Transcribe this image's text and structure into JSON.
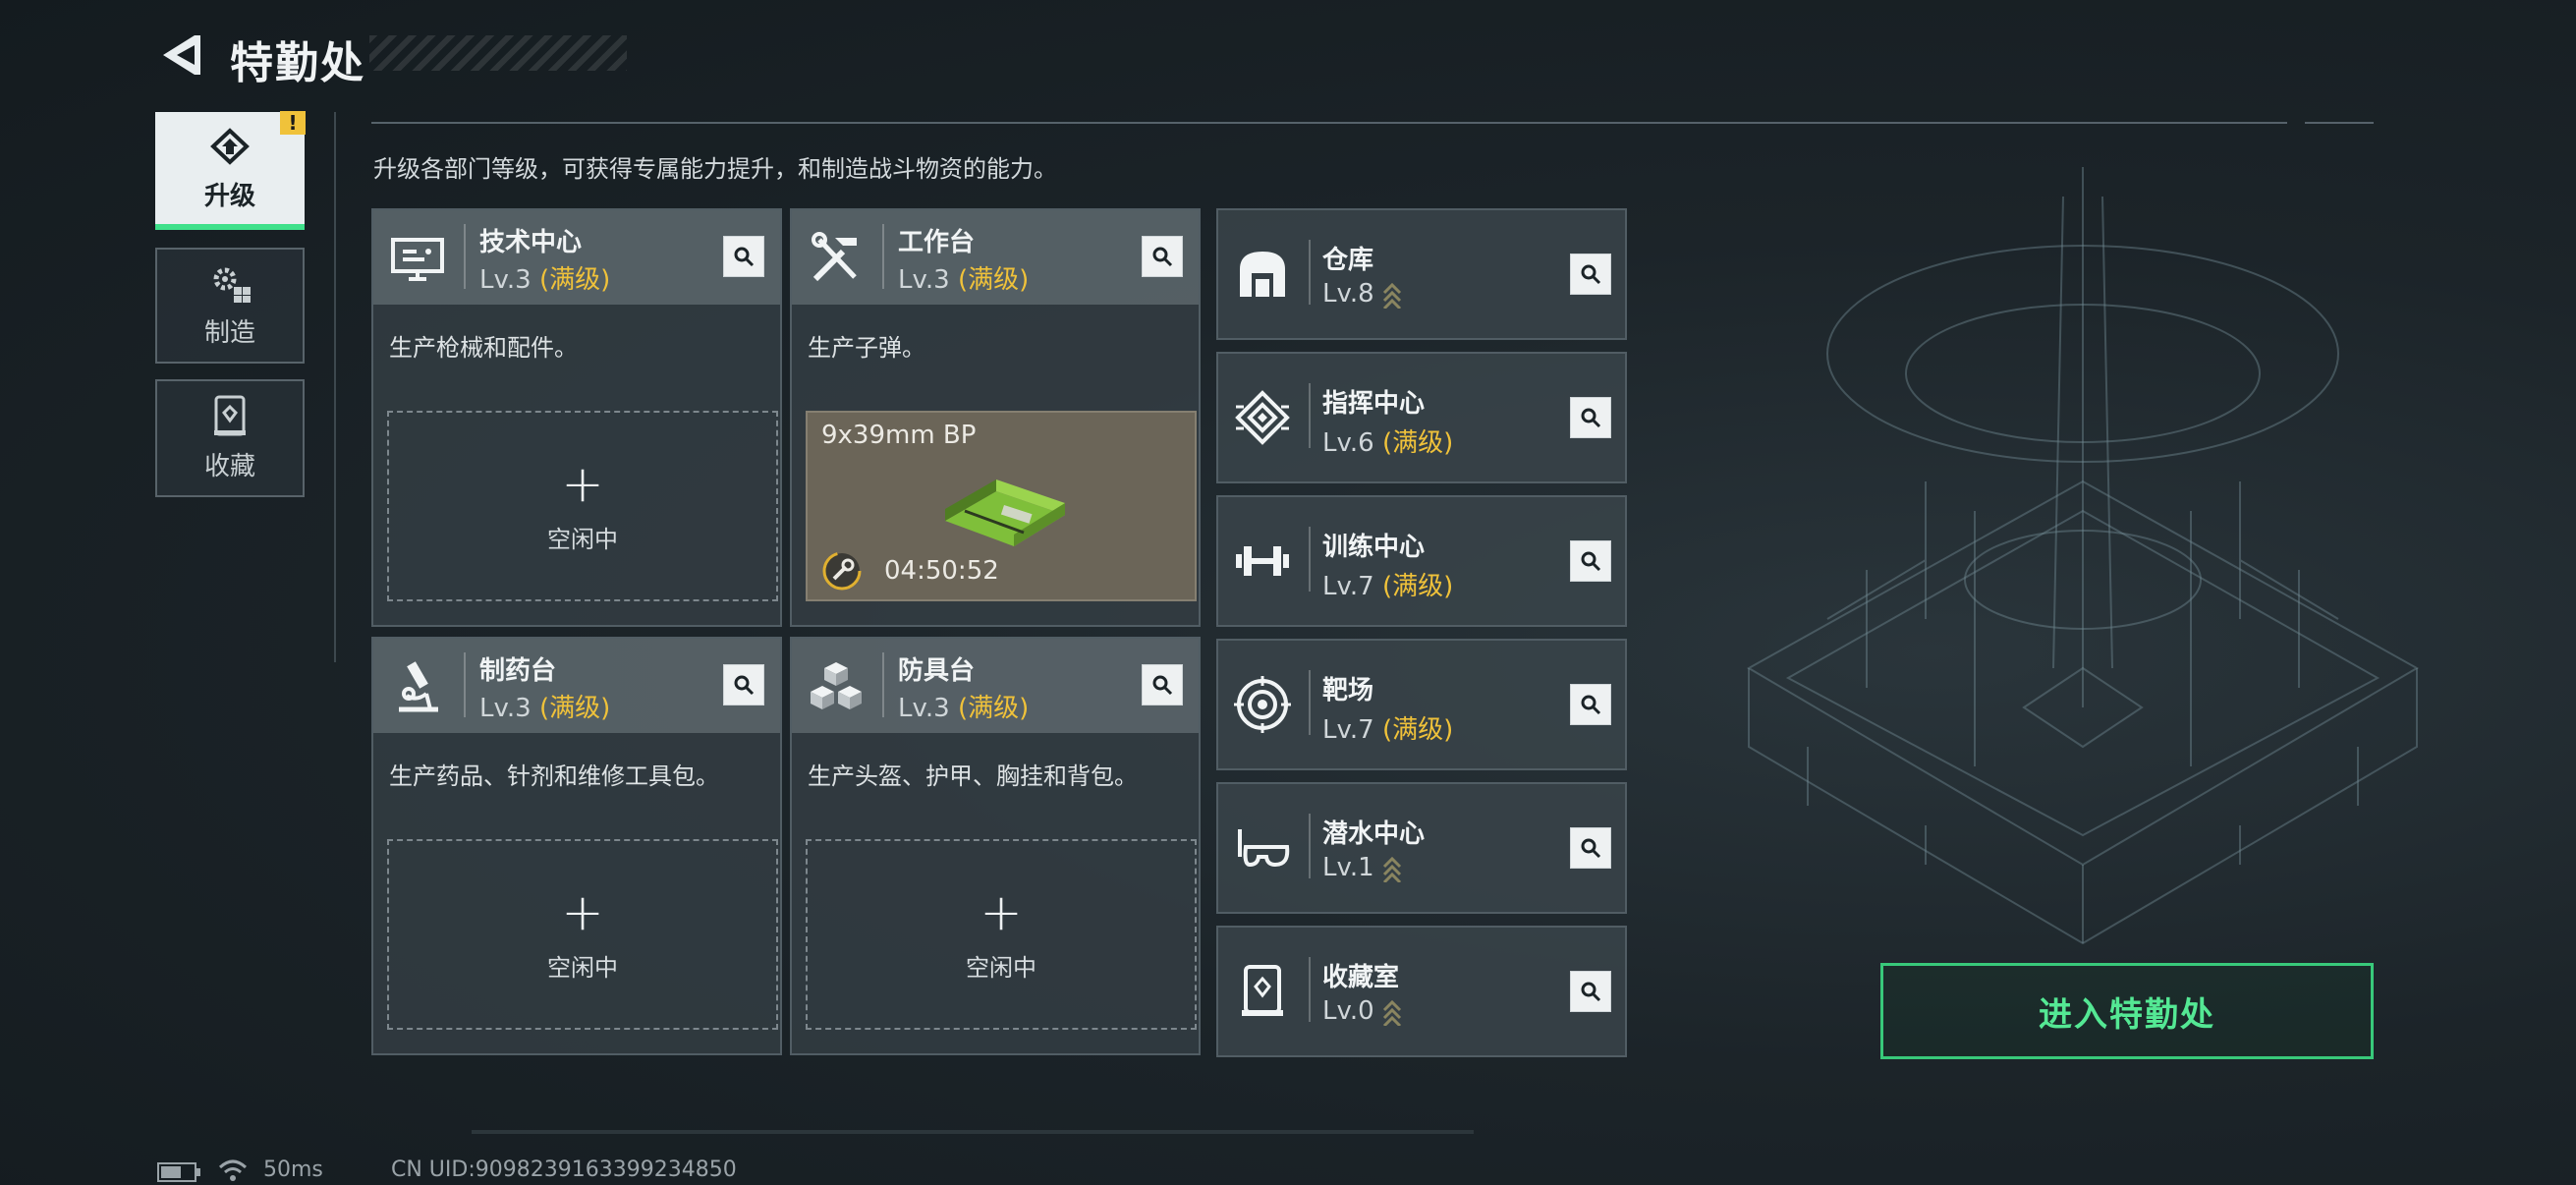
{
  "header": {
    "title": "特勤处",
    "back_icon": "back-arrow-icon"
  },
  "nav": [
    {
      "label": "升级",
      "icon": "upgrade-icon",
      "active": true,
      "alert": "!"
    },
    {
      "label": "制造",
      "icon": "gears-icon",
      "active": false
    },
    {
      "label": "收藏",
      "icon": "collection-icon",
      "active": false
    }
  ],
  "subtitle": "升级各部门等级，可获得专属能力提升，和制造战斗物资的能力。",
  "big_cards": [
    {
      "name": "技术中心",
      "level": "Lv.3",
      "status": "(满级)",
      "desc": "生产枪械和配件。",
      "icon": "monitor-icon",
      "slot": {
        "state": "idle",
        "plus": "+",
        "text": "空闲中"
      }
    },
    {
      "name": "工作台",
      "level": "Lv.3",
      "status": "(满级)",
      "desc": "生产子弹。",
      "icon": "tools-icon",
      "slot": {
        "state": "producing",
        "item": "9x39mm BP",
        "timer": "04:50:52"
      }
    },
    {
      "name": "制药台",
      "level": "Lv.3",
      "status": "(满级)",
      "desc": "生产药品、针剂和维修工具包。",
      "icon": "microscope-icon",
      "slot": {
        "state": "idle",
        "plus": "+",
        "text": "空闲中"
      }
    },
    {
      "name": "防具台",
      "level": "Lv.3",
      "status": "(满级)",
      "desc": "生产头盔、护甲、胸挂和背包。",
      "icon": "armor-cubes-icon",
      "slot": {
        "state": "idle",
        "plus": "+",
        "text": "空闲中"
      }
    }
  ],
  "small_cards": [
    {
      "name": "仓库",
      "level": "Lv.8",
      "status": "",
      "upgradable": true,
      "icon": "warehouse-icon"
    },
    {
      "name": "指挥中心",
      "level": "Lv.6",
      "status": "(满级)",
      "upgradable": false,
      "icon": "command-chip-icon"
    },
    {
      "name": "训练中心",
      "level": "Lv.7",
      "status": "(满级)",
      "upgradable": false,
      "icon": "dumbbell-icon"
    },
    {
      "name": "靶场",
      "level": "Lv.7",
      "status": "(满级)",
      "upgradable": false,
      "icon": "target-icon"
    },
    {
      "name": "潜水中心",
      "level": "Lv.1",
      "status": "",
      "upgradable": true,
      "icon": "diving-mask-icon"
    },
    {
      "name": "收藏室",
      "level": "Lv.0",
      "status": "",
      "upgradable": true,
      "icon": "collection-room-icon"
    }
  ],
  "enter_button": "进入特勤处",
  "footer": {
    "ping": "50ms",
    "uid": "CN UID:9098239163399234850"
  },
  "colors": {
    "accent_green": "#3ee08a",
    "maxed_gold": "#f0c23a",
    "alert": "#f0c23a"
  }
}
